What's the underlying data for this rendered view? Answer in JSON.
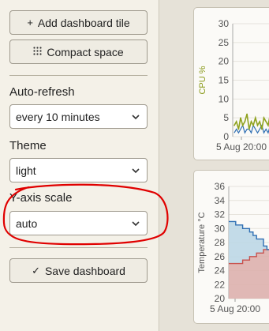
{
  "sidebar": {
    "add_tile_label": "Add dashboard tile",
    "add_tile_icon": "plus-icon",
    "compact_label": "Compact space",
    "compact_icon": "grid-dots-icon",
    "auto_refresh": {
      "label": "Auto-refresh",
      "value": "every 10 minutes"
    },
    "theme": {
      "label": "Theme",
      "value": "light"
    },
    "y_axis_scale": {
      "label": "Y-axis scale",
      "value": "auto"
    },
    "save_label": "Save dashboard",
    "save_icon": "check-icon"
  },
  "colors": {
    "annotation": "#e00000",
    "cpu_series": "#8fa21f",
    "cpu_series_2": "#2f6fb3",
    "temp_upper": "#2f6fb3",
    "temp_upper_fill": "#bcd7e6",
    "temp_lower": "#c8524e",
    "temp_lower_fill": "#ddb0ad"
  },
  "chart_data": [
    {
      "type": "line",
      "ylabel": "CPU %",
      "yticks": [
        "30",
        "25",
        "20",
        "15",
        "10",
        "5",
        "0"
      ],
      "ylim": [
        0,
        30
      ],
      "xtick": "5 Aug 20:00",
      "grid": true,
      "series": [
        {
          "values": [
            3,
            4,
            2,
            5,
            3,
            4,
            6,
            2,
            4,
            3,
            5,
            3,
            4,
            2,
            5,
            4,
            3,
            6,
            3,
            4,
            2,
            5,
            3
          ]
        },
        {
          "values": [
            1,
            2,
            1,
            2,
            3,
            1,
            2,
            2,
            1,
            3,
            2,
            1,
            2,
            3,
            1,
            2,
            1,
            3,
            2,
            1,
            2,
            1,
            2
          ]
        }
      ]
    },
    {
      "type": "area",
      "ylabel": "Temperature °C",
      "yticks": [
        "36",
        "34",
        "32",
        "30",
        "28",
        "26",
        "24",
        "22",
        "20"
      ],
      "ylim": [
        20,
        36
      ],
      "xtick": "5 Aug 20:00",
      "grid": true,
      "series": [
        {
          "values": [
            31,
            31,
            30.5,
            30.5,
            30,
            30,
            29.5,
            29,
            28.5,
            28.5,
            27.5,
            27,
            27,
            27,
            27,
            27
          ]
        },
        {
          "values": [
            25,
            25,
            25,
            25,
            25.5,
            25.5,
            26,
            26,
            26.5,
            26.5,
            27,
            27,
            27,
            27,
            27,
            27
          ]
        }
      ]
    }
  ]
}
